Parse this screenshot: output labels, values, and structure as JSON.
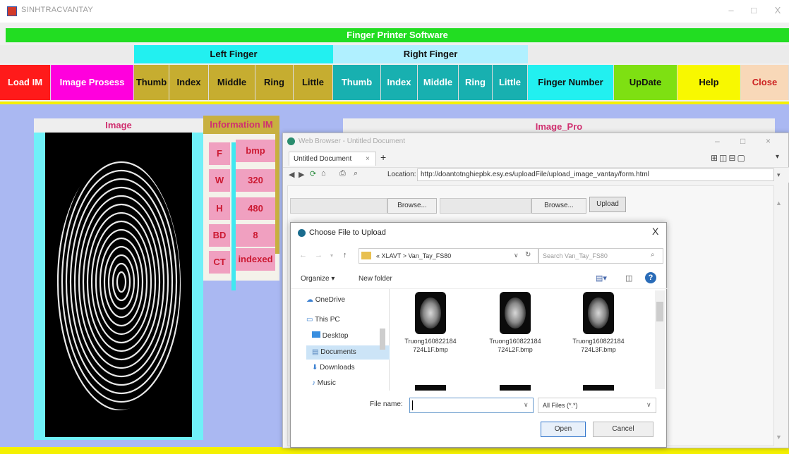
{
  "window": {
    "title": "SINHTRACVANTAY",
    "controls": [
      "–",
      "□",
      "X"
    ]
  },
  "software": {
    "title": "Finger Printer Software",
    "left_finger": "Left Finger",
    "right_finger": "Right Finger"
  },
  "buttons": [
    {
      "label": "Load IM",
      "bg": "#ff1a1a",
      "fg": "#ffffff"
    },
    {
      "label": "Image Prosess",
      "bg": "#ff00dd",
      "fg": "#ffffff"
    },
    {
      "label": "Thumb",
      "bg": "#c6ad30",
      "fg": "#111111"
    },
    {
      "label": "Index",
      "bg": "#c6ad30",
      "fg": "#111111"
    },
    {
      "label": "Middle",
      "bg": "#c6ad30",
      "fg": "#111111"
    },
    {
      "label": "Ring",
      "bg": "#c6ad30",
      "fg": "#111111"
    },
    {
      "label": "Little",
      "bg": "#c6ad30",
      "fg": "#111111"
    },
    {
      "label": "Thumb",
      "bg": "#18b0b0",
      "fg": "#ffffff"
    },
    {
      "label": "Index",
      "bg": "#18b0b0",
      "fg": "#ffffff"
    },
    {
      "label": "Middle",
      "bg": "#18b0b0",
      "fg": "#ffffff"
    },
    {
      "label": "Ring",
      "bg": "#18b0b0",
      "fg": "#ffffff"
    },
    {
      "label": "Little",
      "bg": "#18b0b0",
      "fg": "#ffffff"
    },
    {
      "label": "Finger Number",
      "bg": "#22f0f0",
      "fg": "#111111"
    },
    {
      "label": "UpDate",
      "bg": "#7ee012",
      "fg": "#111111"
    },
    {
      "label": "Help",
      "bg": "#f8f800",
      "fg": "#111111"
    },
    {
      "label": "Close",
      "bg": "#f8d8b8",
      "fg": "#cc2222"
    }
  ],
  "image_panel": {
    "title": "Image"
  },
  "info": {
    "title": "Information IM",
    "rows": [
      {
        "label": "F",
        "value": "bmp"
      },
      {
        "label": "W",
        "value": "320"
      },
      {
        "label": "H",
        "value": "480"
      },
      {
        "label": "BD",
        "value": "8"
      },
      {
        "label": "CT",
        "value": "indexed"
      }
    ]
  },
  "image_pro": {
    "title": "Image_Pro"
  },
  "browser": {
    "title": "Web Browser - Untitled Document",
    "tab": "Untitled Document",
    "tab_close": "×",
    "new_tab": "+",
    "location_label": "Location:",
    "url": "http://doantotnghiepbk.esy.es/uploadFile/upload_image_vantay/form.html",
    "browse1": "Browse...",
    "browse2": "Browse...",
    "upload": "Upload"
  },
  "dialog": {
    "title": "Choose File to Upload",
    "close": "X",
    "path": "« XLAVT  >  Van_Tay_FS80",
    "search_placeholder": "Search Van_Tay_FS80",
    "organize": "Organize ▾",
    "new_folder": "New folder",
    "tree": [
      "OneDrive",
      "This PC",
      "Desktop",
      "Documents",
      "Downloads",
      "Music"
    ],
    "files": [
      {
        "name1": "Truong160822184",
        "name2": "724L1F.bmp"
      },
      {
        "name1": "Truong160822184",
        "name2": "724L2F.bmp"
      },
      {
        "name1": "Truong160822184",
        "name2": "724L3F.bmp"
      }
    ],
    "filename_label": "File name:",
    "filename_value": "",
    "filetype": "All Files (*.*)",
    "open": "Open",
    "cancel": "Cancel"
  }
}
